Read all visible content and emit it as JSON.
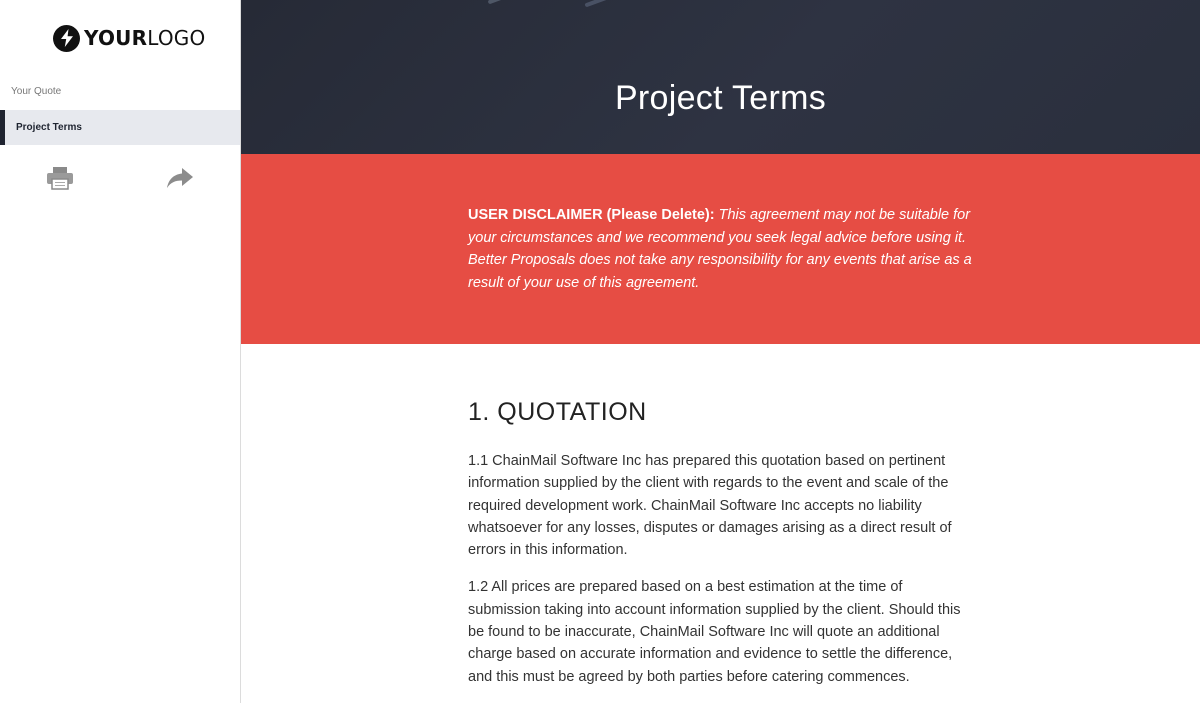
{
  "sidebar": {
    "logo": {
      "bold": "YOUR",
      "light": "LOGO"
    },
    "section_label": "Your Quote",
    "active_item": "Project Terms",
    "tools": [
      {
        "icon": "print-icon"
      },
      {
        "icon": "share-arrow-icon"
      }
    ]
  },
  "hero": {
    "title": "Project Terms"
  },
  "disclaimer": {
    "lead": "USER DISCLAIMER (Please Delete):",
    "body": " This agreement may not be suitable for your circumstances and we recommend you seek legal advice before using it. Better Proposals does not take any responsibility for any events that arise as a result of your use of this agreement."
  },
  "content": {
    "heading": "1. QUOTATION",
    "paragraphs": [
      "1.1 ChainMail Software Inc has prepared this quotation based on pertinent information supplied by the client with regards to the event and scale of the required development work. ChainMail Software Inc accepts no liability whatsoever for any losses, disputes or damages arising as a direct result of errors in this information.",
      "1.2 All prices are prepared based on a best estimation at the time of submission taking into account information supplied by the client.  Should this be found to be inaccurate, ChainMail Software Inc will quote an additional charge based on accurate information and evidence to settle the difference, and this must be agreed by both parties before catering commences."
    ]
  },
  "colors": {
    "accent_red": "#e64d44",
    "hero_dark": "#2a2f3d",
    "sidebar_active_bg": "#e7e9ee"
  }
}
